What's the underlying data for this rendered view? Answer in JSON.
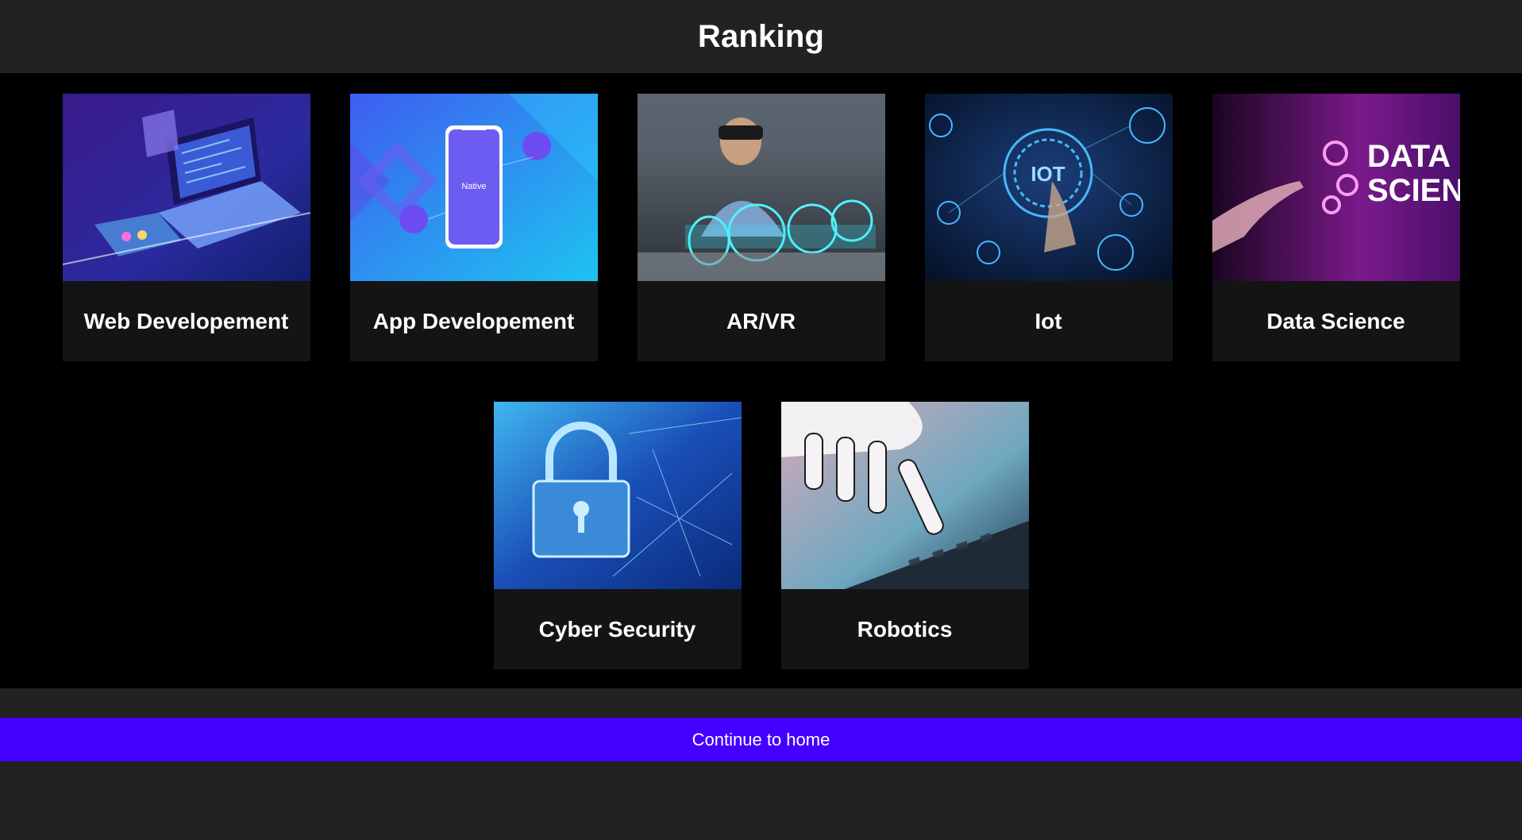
{
  "header": {
    "title": "Ranking"
  },
  "cards": [
    {
      "label": "Web Developement",
      "image": "laptop-code-illustration"
    },
    {
      "label": "App Developement",
      "image": "mobile-native-illustration",
      "thumb_text": "Native"
    },
    {
      "label": "AR/VR",
      "image": "ar-headset-photo"
    },
    {
      "label": "Iot",
      "image": "iot-hud-photo",
      "thumb_text": "IOT"
    },
    {
      "label": "Data Science",
      "image": "data-science-photo",
      "thumb_text_1": "DATA",
      "thumb_text_2": "SCIENC"
    },
    {
      "label": "Cyber Security",
      "image": "padlock-network-illustration"
    },
    {
      "label": "Robotics",
      "image": "robot-hand-photo"
    }
  ],
  "footer": {
    "continue_label": "Continue to home"
  },
  "colors": {
    "header_bg": "#222222",
    "card_bg": "#141414",
    "button_bg": "#4400ff"
  }
}
